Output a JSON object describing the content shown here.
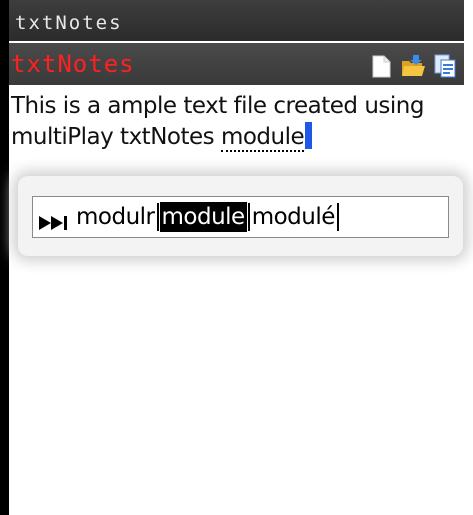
{
  "status_bar": {
    "title": "txtNotes"
  },
  "app_header": {
    "title": "txtNotes",
    "toolbar": [
      {
        "name": "new-file-icon",
        "label": "New"
      },
      {
        "name": "open-folder-icon",
        "label": "Open"
      },
      {
        "name": "save-file-icon",
        "label": "Save"
      }
    ]
  },
  "editor": {
    "line1": "This is a ample text file created using",
    "line2_prefix": "multiPlay txtNotes ",
    "line2_current_word": "module"
  },
  "suggestions": {
    "items": [
      "modulr",
      "module",
      "modulé"
    ],
    "selected_index": 1
  },
  "colors": {
    "app_title": "#ff2020",
    "caret": "#1f57e8",
    "header_bg": "#3a3a3a"
  }
}
